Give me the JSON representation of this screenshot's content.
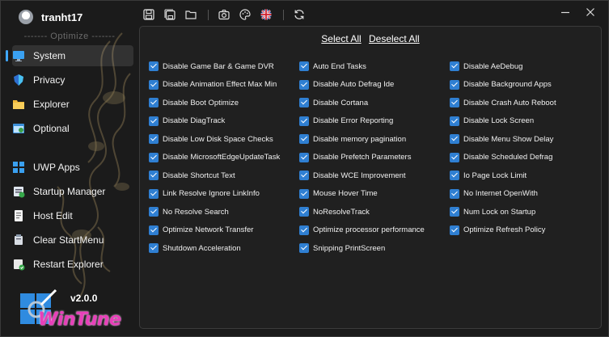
{
  "app": {
    "user_name": "tranht17",
    "section_caption": "------- Optimize -------",
    "version": "v2.0.0",
    "logo_text": "WinTune"
  },
  "sidebar": {
    "items": [
      {
        "label": "System",
        "icon": "monitor-icon",
        "active": true
      },
      {
        "label": "Privacy",
        "icon": "privacy-shield-icon",
        "active": false
      },
      {
        "label": "Explorer",
        "icon": "folder-icon",
        "active": false
      },
      {
        "label": "Optional",
        "icon": "optional-window-icon",
        "active": false
      },
      {
        "label": "UWP Apps",
        "icon": "apps-grid-icon",
        "active": false
      },
      {
        "label": "Startup Manager",
        "icon": "startup-icon",
        "active": false
      },
      {
        "label": "Host Edit",
        "icon": "hosts-file-icon",
        "active": false
      },
      {
        "label": "Clear StartMenu",
        "icon": "broom-icon",
        "active": false
      },
      {
        "label": "Restart Explorer",
        "icon": "restart-explorer-icon",
        "active": false
      }
    ]
  },
  "toolbar": {
    "icons": [
      "save-icon",
      "save-all-icon",
      "open-folder-icon",
      "camera-icon",
      "theme-palette-icon",
      "uk-flag-icon",
      "refresh-icon"
    ]
  },
  "main": {
    "select_all": "Select All",
    "deselect_all": "Deselect All",
    "columns": [
      [
        "Disable Game Bar & Game DVR",
        "Disable Animation Effect Max Min",
        "Disable Boot Optimize",
        "Disable DiagTrack",
        "Disable Low Disk Space Checks",
        "Disable MicrosoftEdgeUpdateTask",
        "Disable Shortcut Text",
        "Link Resolve Ignore LinkInfo",
        "No Resolve Search",
        "Optimize Network Transfer",
        "Shutdown Acceleration"
      ],
      [
        "Auto End Tasks",
        "Disable Auto Defrag Ide",
        "Disable Cortana",
        "Disable Error Reporting",
        "Disable memory pagination",
        "Disable Prefetch Parameters",
        "Disable WCE Improvement",
        "Mouse Hover Time",
        "NoResolveTrack",
        "Optimize processor performance",
        "Snipping PrintScreen"
      ],
      [
        "Disable AeDebug",
        "Disable Background Apps",
        "Disable Crash Auto Reboot",
        "Disable Lock Screen",
        "Disable Menu Show Delay",
        "Disable Scheduled Defrag",
        "Io Page Lock Limit",
        "No Internet OpenWith",
        "Num Lock on Startup",
        "Optimize Refresh Policy"
      ]
    ]
  },
  "colors": {
    "background": "#1b1b1b",
    "panel": "#202020",
    "checkbox_accent": "#2f7fd2",
    "logo_pink": "#e83fb9"
  }
}
